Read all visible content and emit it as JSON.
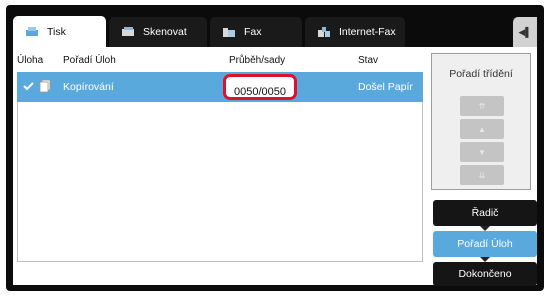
{
  "tabs": [
    {
      "label": "Tisk",
      "icon": "print-icon"
    },
    {
      "label": "Skenovat",
      "icon": "scan-icon"
    },
    {
      "label": "Fax",
      "icon": "fax-icon"
    },
    {
      "label": "Internet-Fax",
      "icon": "internet-fax-icon"
    }
  ],
  "right_tab_glyph": "◀▌",
  "columns": {
    "task": "Úloha",
    "order": "Pořadí Úloh",
    "progress": "Průběh/sady",
    "status": "Stav"
  },
  "job": {
    "name": "Kopírování",
    "progress": "0050/0050",
    "status": "Došel Papír",
    "icon": "copy-document-icon"
  },
  "sort_panel": {
    "title": "Pořadí třídění",
    "arrows": [
      "⇈",
      "▲",
      "▼",
      "⇊"
    ]
  },
  "buttons": {
    "spooler": "Řadič",
    "job_queue": "Pořadí Úloh",
    "completed": "Dokončeno"
  },
  "colors": {
    "accent_blue": "#5aa9dd",
    "highlight_red": "#e0112b",
    "frame_black": "#0b0b0b"
  }
}
